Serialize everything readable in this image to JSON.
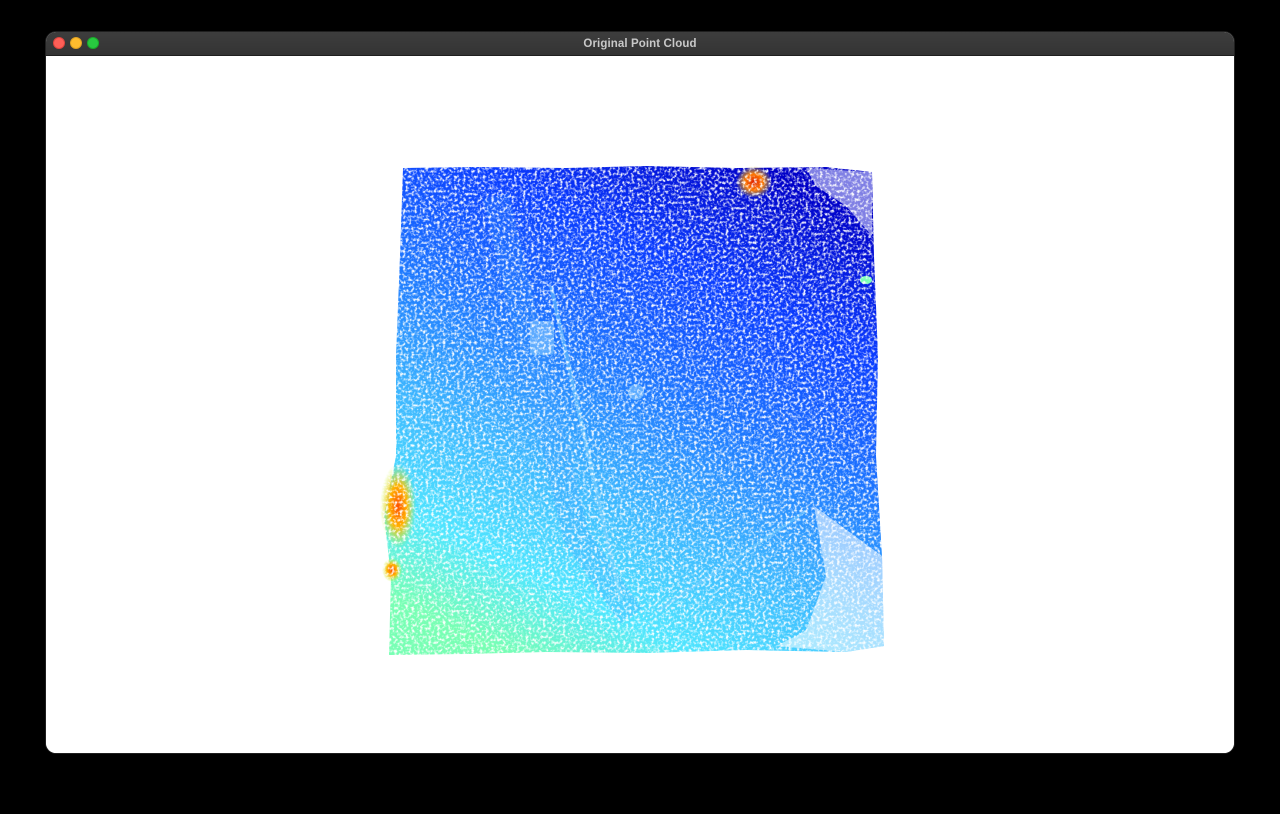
{
  "window": {
    "title": "Original Point Cloud",
    "controls": {
      "close_icon": "close-icon",
      "minimize_icon": "minimize-icon",
      "maximize_icon": "maximize-icon"
    }
  },
  "viewport": {
    "background": "#ffffff",
    "colormap": [
      "#0000c8",
      "#0a3cff",
      "#1e78ff",
      "#3cb4ff",
      "#50e6ff",
      "#78ffb4",
      "#c8ff3c",
      "#ffb400",
      "#ff5000",
      "#dc1e00"
    ]
  }
}
